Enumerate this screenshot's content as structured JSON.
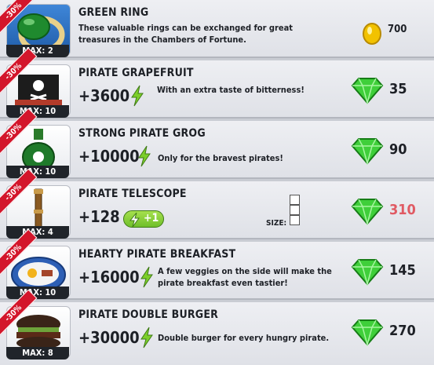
{
  "items": [
    {
      "title": "GREEN RING",
      "discount": "-30%",
      "max": "MAX: 2",
      "description": "These valuable rings can be exchanged for great treasures in the Chambers of Fortune.",
      "price": "700",
      "currency": "coin",
      "thumb_icon": "green-ring-icon"
    },
    {
      "title": "PIRATE GRAPEFRUIT",
      "discount": "-30%",
      "max": "MAX: 10",
      "energy": "+3600",
      "description": "With an extra taste of bitterness!",
      "price": "35",
      "currency": "gem",
      "thumb_icon": "pirate-flag-icon"
    },
    {
      "title": "STRONG PIRATE GROG",
      "discount": "-30%",
      "max": "MAX: 10",
      "energy": "+10000",
      "description": "Only for the bravest pirates!",
      "price": "90",
      "currency": "gem",
      "thumb_icon": "grog-bottle-icon"
    },
    {
      "title": "PIRATE TELESCOPE",
      "discount": "-30%",
      "max": "MAX: 4",
      "energy": "+128",
      "bonus": "+1",
      "size_label": "SIZE:",
      "price": "310",
      "price_color": "#e05a63",
      "currency": "gem",
      "thumb_icon": "telescope-icon"
    },
    {
      "title": "HEARTY PIRATE BREAKFAST",
      "discount": "-30%",
      "max": "MAX: 10",
      "energy": "+16000",
      "description": "A few veggies on the side will make the pirate breakfast even tastier!",
      "price": "145",
      "currency": "gem",
      "thumb_icon": "breakfast-plate-icon"
    },
    {
      "title": "PIRATE DOUBLE BURGER",
      "discount": "-30%",
      "max": "MAX: 8",
      "energy": "+30000",
      "description": "Double burger for every hungry pirate.",
      "price": "270",
      "currency": "gem",
      "thumb_icon": "double-burger-icon"
    }
  ],
  "colors": {
    "ribbon": "#d3162b",
    "gem": "#3fcf3a",
    "coin": "#f2c200",
    "bolt": "#7ccf2a",
    "row_bg": "#e8e9ee"
  }
}
